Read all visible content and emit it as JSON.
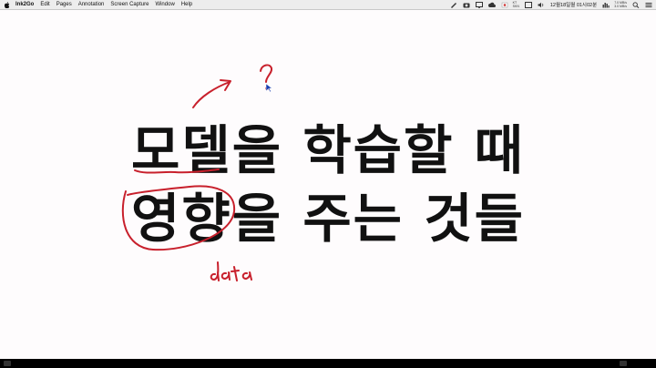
{
  "menubar": {
    "app_name": "Ink2Go",
    "items": [
      "Edit",
      "Pages",
      "Annotation",
      "Screen Capture",
      "Window",
      "Help"
    ],
    "status": {
      "tiny_1": [
        "KT",
        "SKN"
      ],
      "tiny_2": [
        "7.0 MB/s",
        "3.0 MB/s"
      ],
      "date_time": "12월18일월  01시02분"
    }
  },
  "slide": {
    "line1": "모델을 학습할 때",
    "line2": "영향을 주는 것들"
  },
  "annotations": {
    "question_mark": "?",
    "handwritten_note": "data",
    "ink_color": "#c8202c"
  }
}
